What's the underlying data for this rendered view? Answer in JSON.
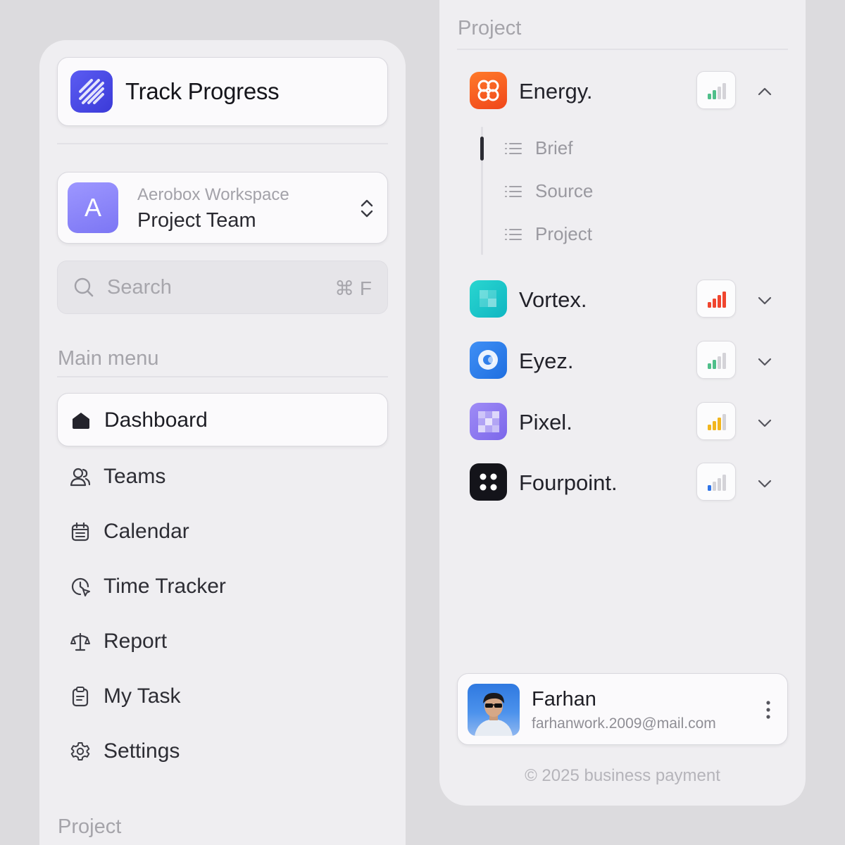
{
  "brand": {
    "title": "Track Progress",
    "logo_icon": "diagonal-stripes-logo"
  },
  "workspace": {
    "avatar_letter": "A",
    "subtitle": "Aerobox Workspace",
    "name": "Project Team"
  },
  "search": {
    "placeholder": "Search",
    "shortcut": "⌘ F"
  },
  "main_menu": {
    "label": "Main menu",
    "items": [
      {
        "label": "Dashboard",
        "icon": "home-icon",
        "active": true
      },
      {
        "label": "Teams",
        "icon": "users-icon"
      },
      {
        "label": "Calendar",
        "icon": "calendar-icon"
      },
      {
        "label": "Time Tracker",
        "icon": "clock-icon"
      },
      {
        "label": "Report",
        "icon": "scale-icon"
      },
      {
        "label": "My Task",
        "icon": "clipboard-icon"
      },
      {
        "label": "Settings",
        "icon": "gear-icon"
      }
    ]
  },
  "left_project_label": "Project",
  "right_panel": {
    "section_label": "Project",
    "projects": [
      {
        "name": "Energy.",
        "signal_color": "#4fbf8a",
        "signal_level": 2,
        "expanded": true,
        "subitems": [
          "Brief",
          "Source",
          "Project"
        ]
      },
      {
        "name": "Vortex.",
        "signal_color": "#f0452e",
        "signal_level": 4,
        "expanded": false
      },
      {
        "name": "Eyez.",
        "signal_color": "#4fbf8a",
        "signal_level": 2,
        "expanded": false
      },
      {
        "name": "Pixel.",
        "signal_color": "#f2b61e",
        "signal_level": 3,
        "expanded": false
      },
      {
        "name": "Fourpoint.",
        "signal_color": "#2f74e8",
        "signal_level": 1,
        "expanded": false
      }
    ]
  },
  "user": {
    "name": "Farhan",
    "email": "farhanwork.2009@mail.com"
  },
  "footer": "© 2025 business payment",
  "colors": {
    "accent": "#4f4ee6",
    "workspace_avatar": "#8b85fb",
    "background": "#dcdbde",
    "panel": "#efeef1"
  }
}
